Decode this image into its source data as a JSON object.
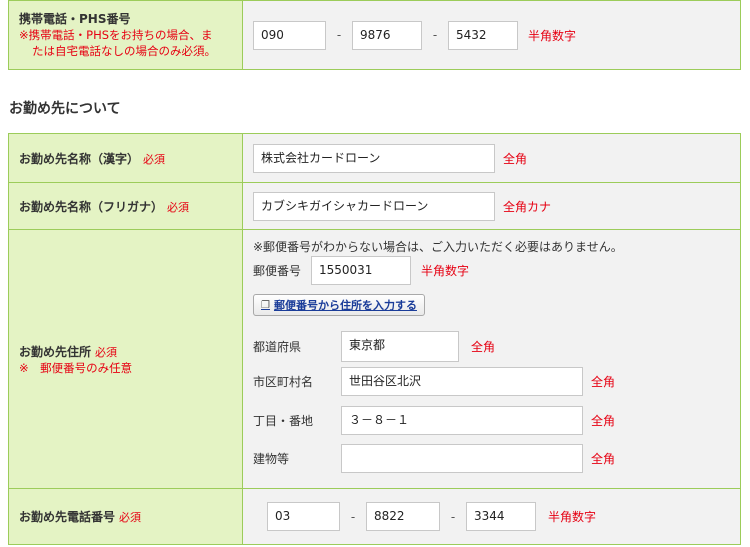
{
  "mobile": {
    "label": "携帯電話・PHS番号",
    "note_line1": "※携帯電話・PHSをお持ちの場合、ま",
    "note_line2": "たは自宅電話なしの場合のみ必須。",
    "part1": "090",
    "part2": "9876",
    "part3": "5432",
    "hint": "半角数字",
    "separator": "-"
  },
  "section_title": "お勤め先について",
  "required_mark": "必須",
  "company_name": {
    "label": "お勤め先名称（漢字）",
    "value": "株式会社カードローン",
    "hint": "全角"
  },
  "company_kana": {
    "label": "お勤め先名称（フリガナ）",
    "value": "カブシキガイシャカードローン",
    "hint": "全角カナ"
  },
  "company_address": {
    "label": "お勤め先住所",
    "note": "※　郵便番号のみ任意",
    "zip_notice": "※郵便番号がわからない場合は、ご入力いただく必要はありません。",
    "zip_label": "郵便番号",
    "zip_value": "1550031",
    "zip_hint": "半角数字",
    "zip_button": "郵便番号から住所を入力する",
    "prefecture_label": "都道府県",
    "prefecture_value": "東京都",
    "prefecture_hint": "全角",
    "city_label": "市区町村名",
    "city_value": "世田谷区北沢",
    "city_hint": "全角",
    "block_label": "丁目・番地",
    "block_value": "３－８－１",
    "block_hint": "全角",
    "building_label": "建物等",
    "building_value": "",
    "building_hint": "全角"
  },
  "company_phone": {
    "label": "お勤め先電話番号",
    "part1": "03",
    "part2": "8822",
    "part3": "3344",
    "hint": "半角数字",
    "separator": "-"
  },
  "colors": {
    "label_bg": "#e4f3c4",
    "field_bg": "#f2f2f2",
    "border": "#9ccc5a",
    "accent_red": "#e60012"
  }
}
